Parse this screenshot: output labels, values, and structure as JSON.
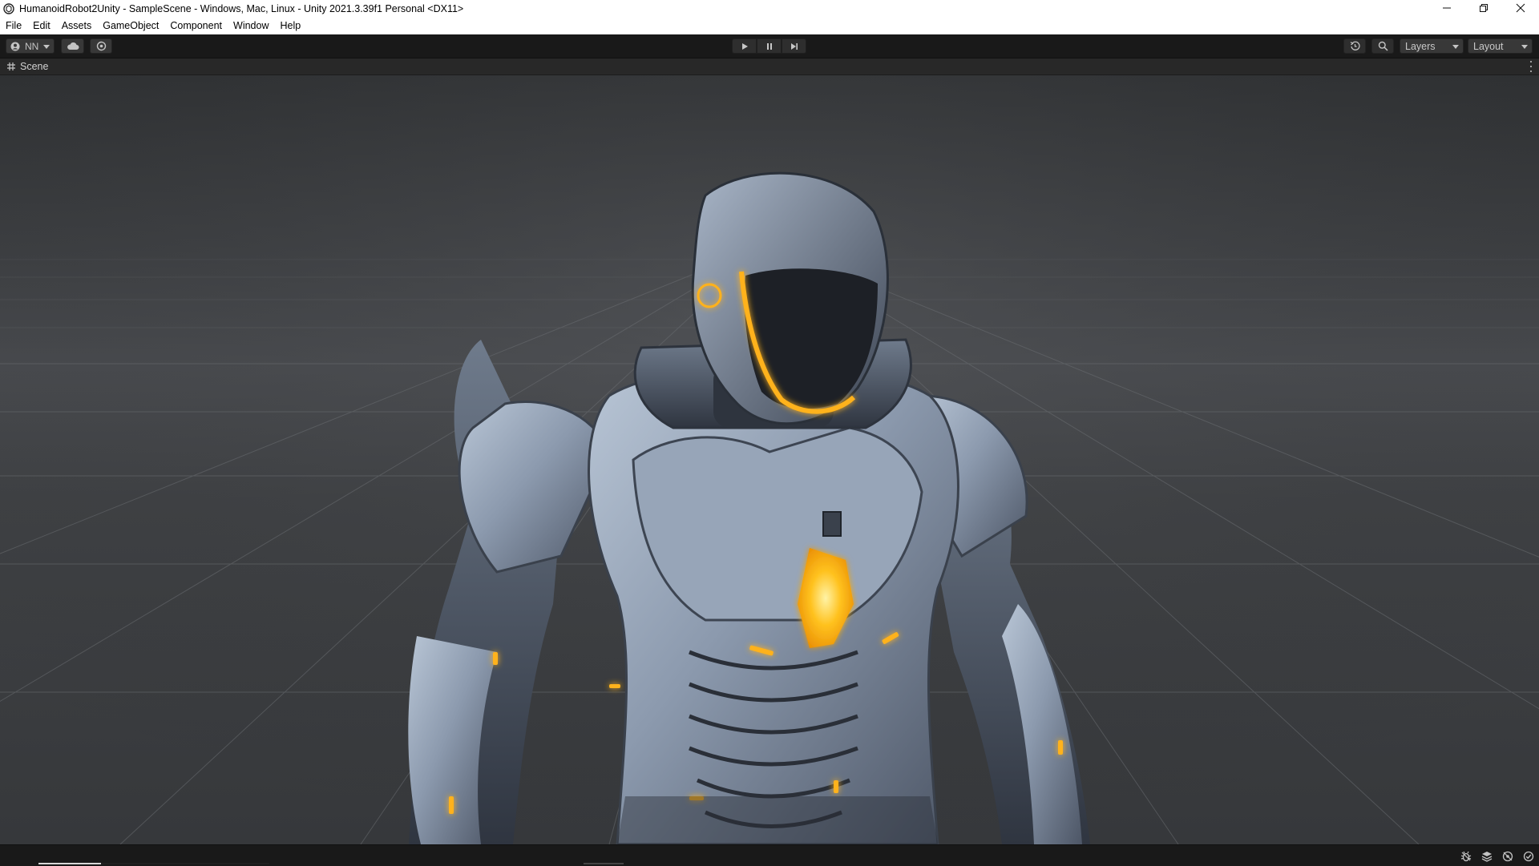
{
  "window": {
    "title": "HumanoidRobot2Unity - SampleScene - Windows, Mac, Linux - Unity 2021.3.39f1 Personal <DX11>",
    "minimize_icon": "minimize-icon",
    "restore_icon": "restore-icon",
    "close_icon": "close-icon"
  },
  "menu": {
    "items": [
      "File",
      "Edit",
      "Assets",
      "GameObject",
      "Component",
      "Window",
      "Help"
    ]
  },
  "toolbar": {
    "account_label": "NN",
    "cloud_icon": "cloud-icon",
    "collab_icon": "collab-icon",
    "play_icon": "play-icon",
    "pause_icon": "pause-icon",
    "step_icon": "step-icon",
    "history_icon": "undo-history-icon",
    "search_icon": "search-icon",
    "layers_label": "Layers",
    "layout_label": "Layout"
  },
  "scene_tab": {
    "label": "Scene",
    "icon": "scene-grid-icon"
  },
  "statusbar": {
    "progress": 0.27,
    "icons": [
      "bug-icon",
      "layers-stack-icon",
      "network-icon",
      "check-circle-icon"
    ]
  },
  "colors": {
    "glow": "#ffb21a",
    "armor": "#8e9cb0",
    "background": "#3c3e41"
  }
}
